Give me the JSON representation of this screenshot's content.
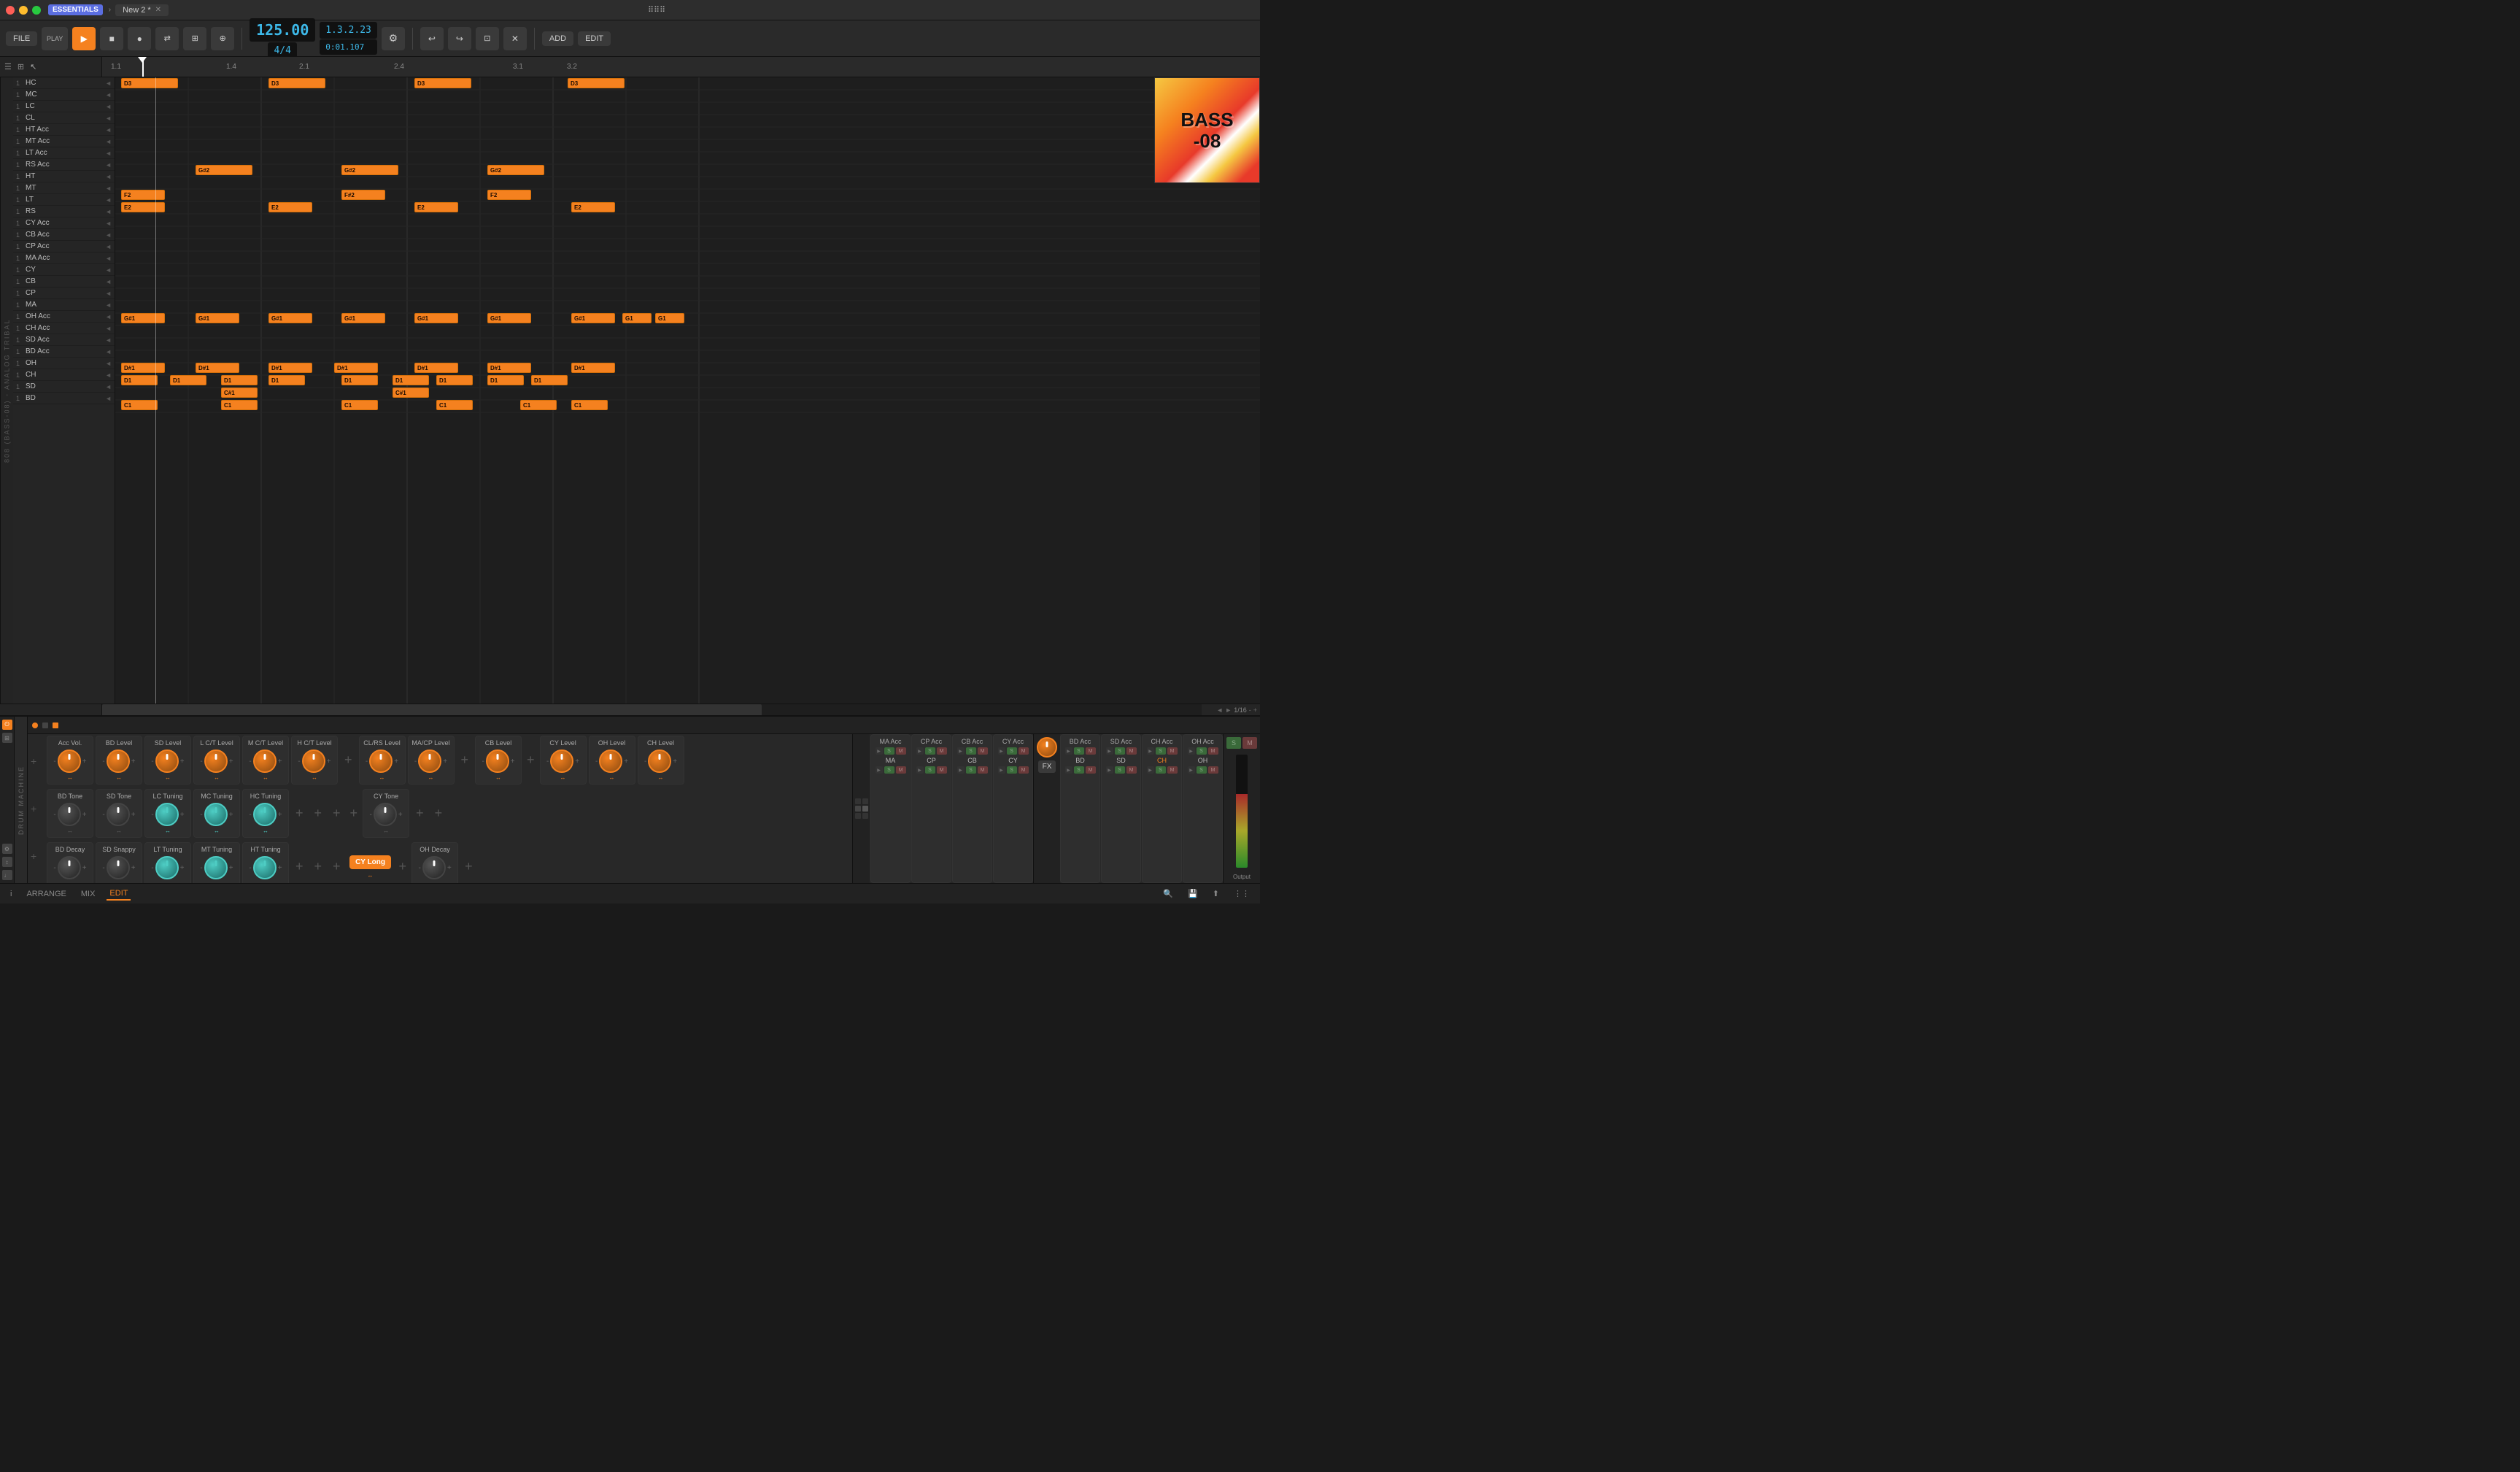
{
  "titlebar": {
    "app_name": "ESSENTIALS",
    "tab_label": "New 2 *",
    "app_title": "⠿⠿⠿"
  },
  "transport": {
    "file_label": "FILE",
    "play_label": "PLAY",
    "tempo": "125.00",
    "time_sig": "4/4",
    "position": "1.3.2.23",
    "time": "0:01.107",
    "add_label": "ADD",
    "edit_label": "EDIT"
  },
  "arrange": {
    "ruler_marks": [
      "1.1",
      "1.4",
      "2.1",
      "2.4",
      "3.1",
      "3.2"
    ],
    "grid_snap": "1/16"
  },
  "tracks": [
    {
      "num": "1",
      "name": "HC"
    },
    {
      "num": "1",
      "name": "MC"
    },
    {
      "num": "1",
      "name": "LC"
    },
    {
      "num": "1",
      "name": "CL"
    },
    {
      "num": "1",
      "name": "HT Acc"
    },
    {
      "num": "1",
      "name": "MT Acc"
    },
    {
      "num": "1",
      "name": "LT Acc"
    },
    {
      "num": "1",
      "name": "RS Acc"
    },
    {
      "num": "1",
      "name": "HT"
    },
    {
      "num": "1",
      "name": "MT"
    },
    {
      "num": "1",
      "name": "LT"
    },
    {
      "num": "1",
      "name": "RS"
    },
    {
      "num": "1",
      "name": "CY Acc"
    },
    {
      "num": "1",
      "name": "CB Acc"
    },
    {
      "num": "1",
      "name": "CP Acc"
    },
    {
      "num": "1",
      "name": "MA Acc"
    },
    {
      "num": "1",
      "name": "CY"
    },
    {
      "num": "1",
      "name": "CB"
    },
    {
      "num": "1",
      "name": "CP"
    },
    {
      "num": "1",
      "name": "MA"
    },
    {
      "num": "1",
      "name": "OH Acc"
    },
    {
      "num": "1",
      "name": "CH Acc"
    },
    {
      "num": "1",
      "name": "SD Acc"
    },
    {
      "num": "1",
      "name": "BD Acc"
    },
    {
      "num": "1",
      "name": "OH"
    },
    {
      "num": "1",
      "name": "CH"
    },
    {
      "num": "1",
      "name": "SD"
    },
    {
      "num": "1",
      "name": "BD"
    }
  ],
  "patterns": [
    {
      "row": 1,
      "col": 0,
      "note": "D3"
    },
    {
      "row": 1,
      "col": 2,
      "note": "D3"
    },
    {
      "row": 1,
      "col": 4,
      "note": "D3"
    },
    {
      "row": 1,
      "col": 6,
      "note": "D3"
    },
    {
      "row": 7,
      "col": 1,
      "note": "G#2"
    },
    {
      "row": 7,
      "col": 3,
      "note": "G#2"
    },
    {
      "row": 7,
      "col": 5,
      "note": "G#2"
    },
    {
      "row": 10,
      "col": 0,
      "note": "F2"
    },
    {
      "row": 10,
      "col": 2,
      "note": "F#2"
    },
    {
      "row": 10,
      "col": 4,
      "note": "F2"
    },
    {
      "row": 11,
      "col": 0,
      "note": "E2"
    },
    {
      "row": 11,
      "col": 2,
      "note": "E2"
    },
    {
      "row": 11,
      "col": 4,
      "note": "E2"
    },
    {
      "row": 11,
      "col": 6,
      "note": "E2"
    },
    {
      "row": 19,
      "col": 0,
      "note": "G#1"
    },
    {
      "row": 19,
      "col": 1,
      "note": "G#1"
    },
    {
      "row": 19,
      "col": 2,
      "note": "G#1"
    },
    {
      "row": 19,
      "col": 3,
      "note": "G#1"
    },
    {
      "row": 19,
      "col": 4,
      "note": "G#1"
    },
    {
      "row": 19,
      "col": 5,
      "note": "G#1"
    },
    {
      "row": 19,
      "col": 6,
      "note": "G#1"
    },
    {
      "row": 24,
      "col": 0,
      "note": "D#1"
    },
    {
      "row": 24,
      "col": 1,
      "note": "D#1"
    },
    {
      "row": 24,
      "col": 2,
      "note": "D#1"
    },
    {
      "row": 25,
      "col": 0,
      "note": "D1"
    },
    {
      "row": 25,
      "col": 1,
      "note": "D1"
    },
    {
      "row": 25,
      "col": 2,
      "note": "D1"
    },
    {
      "row": 26,
      "col": 0,
      "note": "C#1"
    },
    {
      "row": 26,
      "col": 2,
      "note": "C#1"
    },
    {
      "row": 27,
      "col": 0,
      "note": "C1"
    },
    {
      "row": 27,
      "col": 2,
      "note": "C1"
    },
    {
      "row": 27,
      "col": 4,
      "note": "C1"
    }
  ],
  "album_art": {
    "line1": "BASS",
    "line2": "-08"
  },
  "drum_machine": {
    "label": "DRUM MACHINE",
    "knob_groups": [
      {
        "title": "Acc Vol.",
        "knob_type": "orange"
      },
      {
        "title": "BD Level",
        "knob_type": "orange"
      },
      {
        "title": "SD Level",
        "knob_type": "orange"
      },
      {
        "title": "L C/T Level",
        "knob_type": "orange"
      },
      {
        "title": "M C/T Level",
        "knob_type": "orange"
      },
      {
        "title": "H C/T Level",
        "knob_type": "orange"
      },
      {
        "title": "CL/RS Level",
        "knob_type": "orange"
      },
      {
        "title": "MA/CP Level",
        "knob_type": "orange"
      },
      {
        "title": "CB Level",
        "knob_type": "orange"
      },
      {
        "title": "CY Level",
        "knob_type": "orange"
      },
      {
        "title": "OH Level",
        "knob_type": "orange"
      },
      {
        "title": "CH Level",
        "knob_type": "orange"
      }
    ],
    "knob_groups_row2": [
      {
        "title": "BD Tone",
        "knob_type": "default"
      },
      {
        "title": "SD Tone",
        "knob_type": "default"
      },
      {
        "title": "LC Tuning",
        "knob_type": "teal"
      },
      {
        "title": "MC Tuning",
        "knob_type": "teal"
      },
      {
        "title": "HC Tuning",
        "knob_type": "teal"
      },
      {
        "title": "CY Tone",
        "knob_type": "default"
      }
    ],
    "knob_groups_row3": [
      {
        "title": "BD Decay",
        "knob_type": "default"
      },
      {
        "title": "SD Snappy",
        "knob_type": "default"
      },
      {
        "title": "LT Tuning",
        "knob_type": "teal"
      },
      {
        "title": "MT Tuning",
        "knob_type": "teal"
      },
      {
        "title": "HT Tuning",
        "knob_type": "teal"
      },
      {
        "title": "OH Decay",
        "knob_type": "default"
      }
    ],
    "cy_long_label": "CY Long",
    "channel_groups": [
      {
        "title": "MA Acc",
        "name": "MA"
      },
      {
        "title": "CP Acc",
        "name": "CP"
      },
      {
        "title": "CB Acc",
        "name": "CB"
      },
      {
        "title": "CY Acc",
        "name": "CY"
      },
      {
        "title": "BD Acc",
        "name": "BD Acc"
      },
      {
        "title": "SD Acc",
        "name": "SD Acc"
      },
      {
        "title": "CH Acc",
        "name": "CH Acc"
      },
      {
        "title": "OH Acc",
        "name": "OH Acc"
      },
      {
        "title": "BD",
        "name": "BD"
      },
      {
        "title": "SD",
        "name": "SD"
      },
      {
        "title": "CH",
        "name": "CH"
      },
      {
        "title": "OH",
        "name": "OH"
      }
    ],
    "fx_label": "FX",
    "output_label": "Output"
  },
  "bottom_nav": {
    "items": [
      {
        "label": "i",
        "active": false
      },
      {
        "label": "ARRANGE",
        "active": false
      },
      {
        "label": "MIX",
        "active": false
      },
      {
        "label": "EDIT",
        "active": true
      }
    ]
  }
}
